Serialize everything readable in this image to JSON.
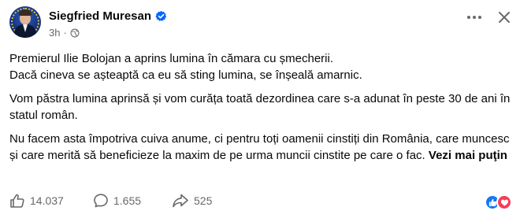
{
  "post": {
    "author_name": "Siegfried Muresan",
    "timestamp": "3h",
    "separator": "·",
    "paragraphs": [
      {
        "line1": "Premierul Ilie Bolojan a aprins lumina în cămara cu șmecherii.",
        "line2": "Dacă cineva se așteaptă ca eu să sting lumina, se înșeală amarnic."
      },
      {
        "text": "Vom păstra lumina aprinsă și vom curăța toată dezordinea care s-a adunat în peste 30 de ani în statul român."
      },
      {
        "text": "Nu facem asta împotriva cuiva anume, ci pentru toți oamenii cinstiți din România, care muncesc și care merită să beneficieze la maxim de pe urma muncii cinstite pe care o fac. "
      }
    ],
    "see_more_label": "Vezi mai puţin"
  },
  "footer": {
    "likes": "14.037",
    "comments": "1.655",
    "shares": "525"
  },
  "colors": {
    "text": "#080809",
    "secondary": "#65686c",
    "verified": "#0866ff",
    "like": "#1877f2",
    "love": "#f33e58"
  },
  "icons": [
    "verified-badge-icon",
    "globe-icon",
    "more-options-icon",
    "close-icon",
    "like-icon",
    "comment-icon",
    "share-icon",
    "like-reaction-icon",
    "love-reaction-icon"
  ]
}
